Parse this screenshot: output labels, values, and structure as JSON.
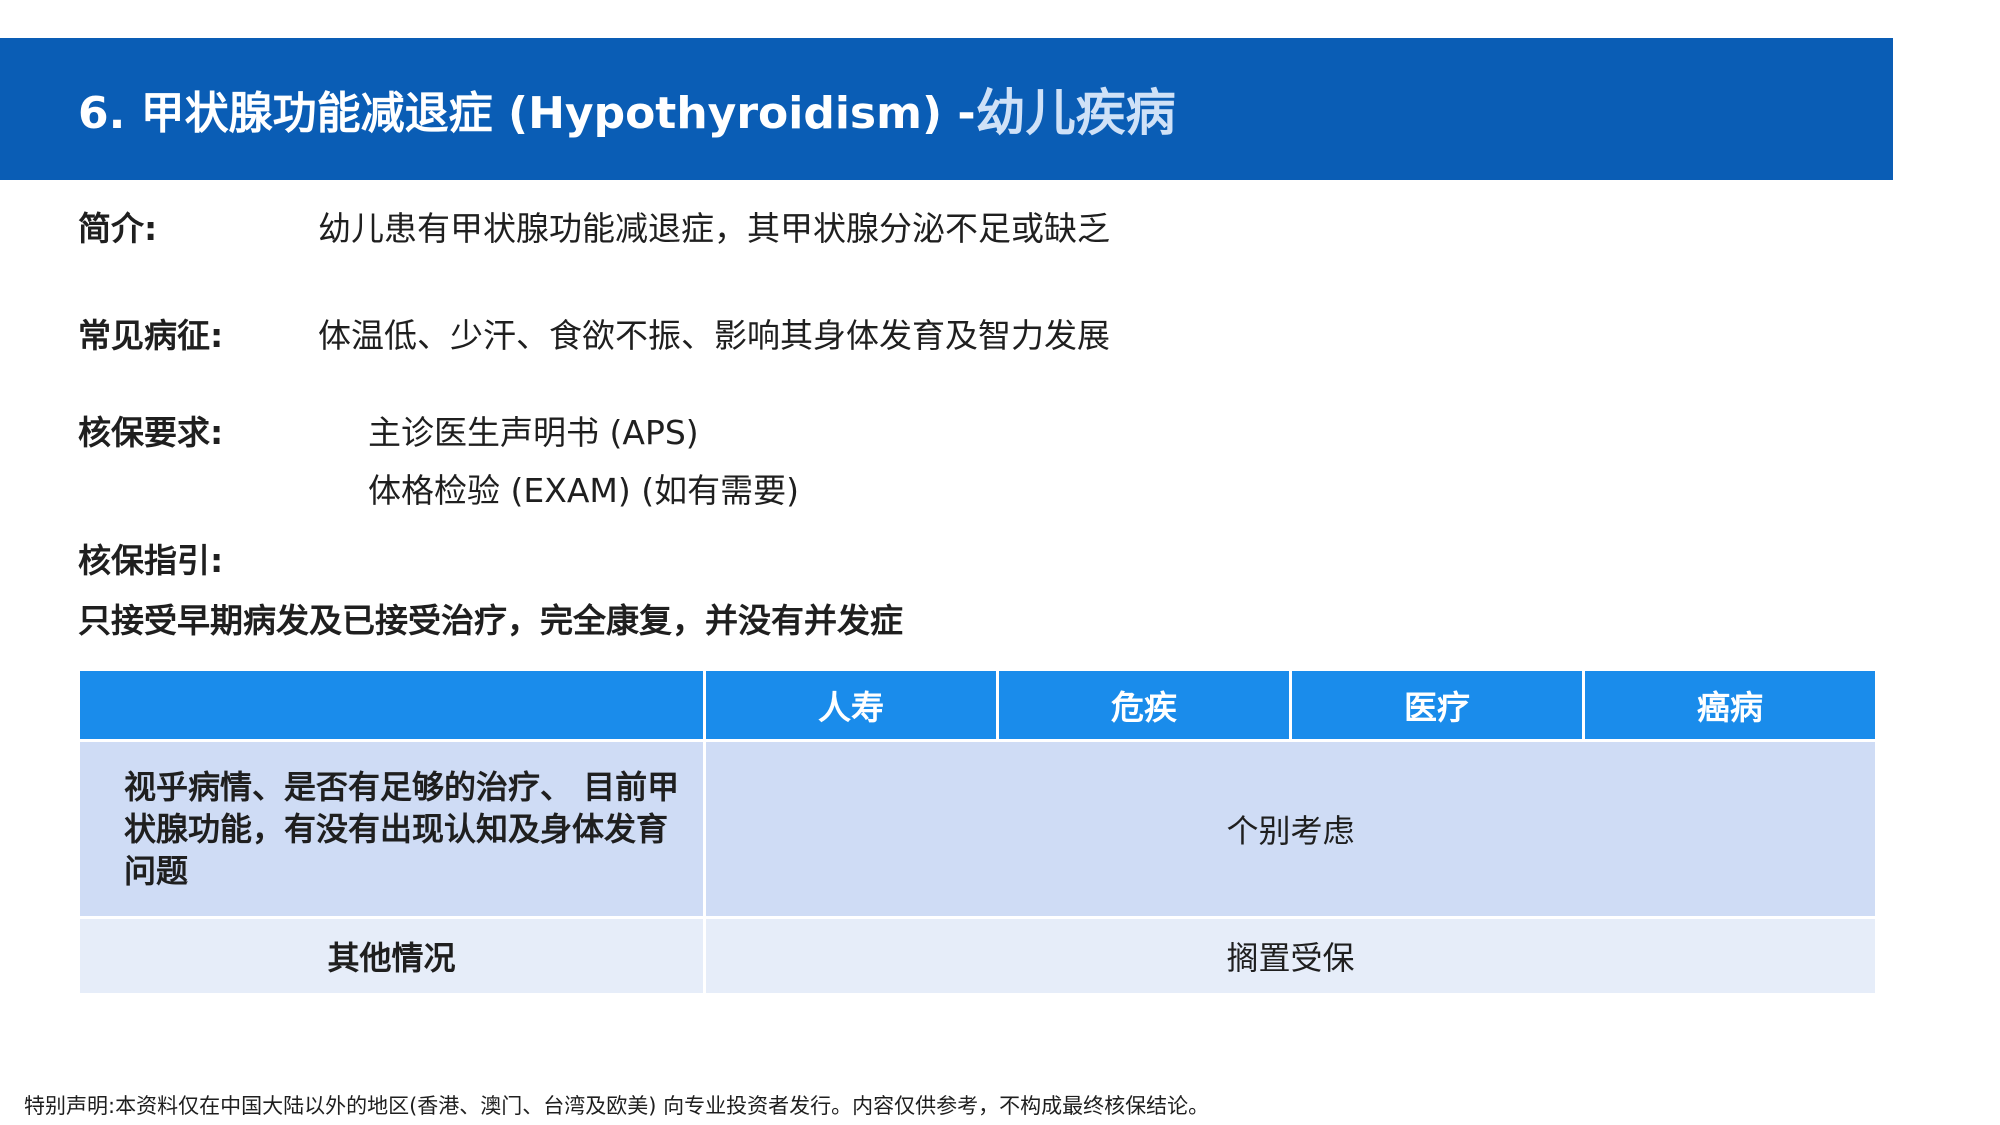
{
  "header": {
    "title": "6. 甲状腺功能减退症 (Hypothyroidism) - ",
    "suffix": "幼儿疾病"
  },
  "intro": {
    "label": "简介:",
    "text": "幼儿患有甲状腺功能减退症，其甲状腺分泌不足或缺乏"
  },
  "symptoms": {
    "label": "常见病征:",
    "text": "体温低、少汗、食欲不振、影响其身体发育及智力发展"
  },
  "requirements": {
    "label": "核保要求:",
    "items": [
      "主诊医生声明书 (APS)",
      "体格检验 (EXAM) (如有需要)"
    ]
  },
  "guidelines": {
    "label": "核保指引:",
    "text": "只接受早期病发及已接受治疗，完全康复，并没有并发症"
  },
  "table": {
    "columns": [
      "",
      "人寿",
      "危疾",
      "医疗",
      "癌病"
    ],
    "rows": [
      {
        "condition": "视乎病情、是否有足够的治疗、 目前甲状腺功能，有没有出现认知及身体发育问题",
        "decision": "个别考虑"
      },
      {
        "condition": "其他情况",
        "decision": "搁置受保"
      }
    ]
  },
  "disclaimer": "特别声明:本资料仅在中国大陆以外的地区(香港、澳门、台湾及欧美) 向专业投资者发行。内容仅供参考，不构成最终核保结论。",
  "colors": {
    "header_bg": "#0a5db5",
    "table_header_bg": "#1a8ceb",
    "row_dark": "#cfdcf5",
    "row_light": "#e6edf9"
  }
}
